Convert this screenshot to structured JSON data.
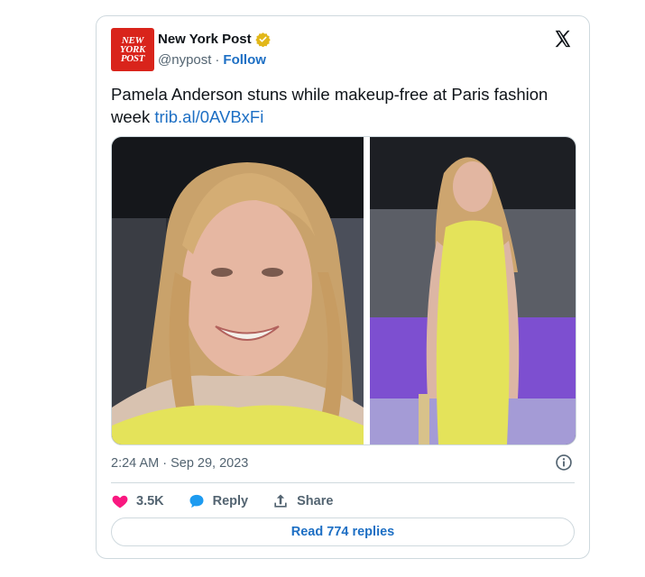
{
  "account": {
    "logo_lines": [
      "NEW",
      "YORK",
      "POST"
    ],
    "name": "New York Post",
    "handle": "@nypost",
    "separator": "·",
    "follow_label": "Follow"
  },
  "tweet": {
    "text": "Pamela Anderson stuns while makeup-free at Paris fashion week",
    "link": "trib.al/0AVBxFi",
    "timestamp": "2:24 AM · Sep 29, 2023"
  },
  "actions": {
    "likes": "3.5K",
    "reply_label": "Reply",
    "share_label": "Share",
    "read_replies": "Read 774 replies"
  },
  "colors": {
    "link": "#1d6fc4",
    "like": "#f91880",
    "reply_icon": "#1d9bf0",
    "verified": "#e2b719",
    "logo_bg": "#d9241b",
    "dress": "#e4e35a"
  },
  "icons": [
    "verified-badge-icon",
    "x-logo-icon",
    "info-icon",
    "heart-icon",
    "reply-icon",
    "share-icon"
  ]
}
